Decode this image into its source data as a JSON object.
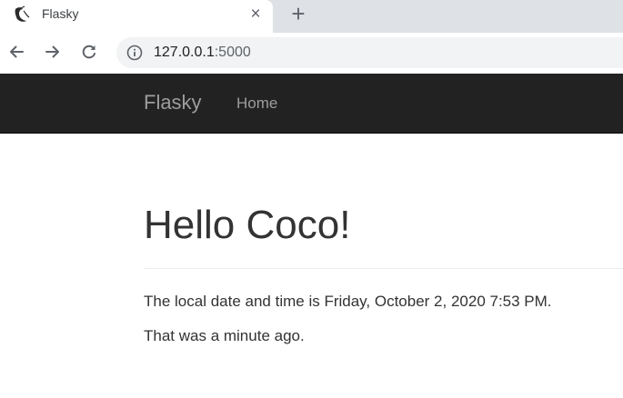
{
  "browser": {
    "tab": {
      "title": "Flasky",
      "close_icon": "×"
    },
    "new_tab_icon": "+",
    "address": {
      "host": "127.0.0.1",
      "port": ":5000"
    }
  },
  "navbar": {
    "brand": "Flasky",
    "items": [
      {
        "label": "Home"
      }
    ]
  },
  "page": {
    "heading": "Hello Coco!",
    "line1": "The local date and time is Friday, October 2, 2020 7:53 PM.",
    "line2": "That was a minute ago."
  }
}
